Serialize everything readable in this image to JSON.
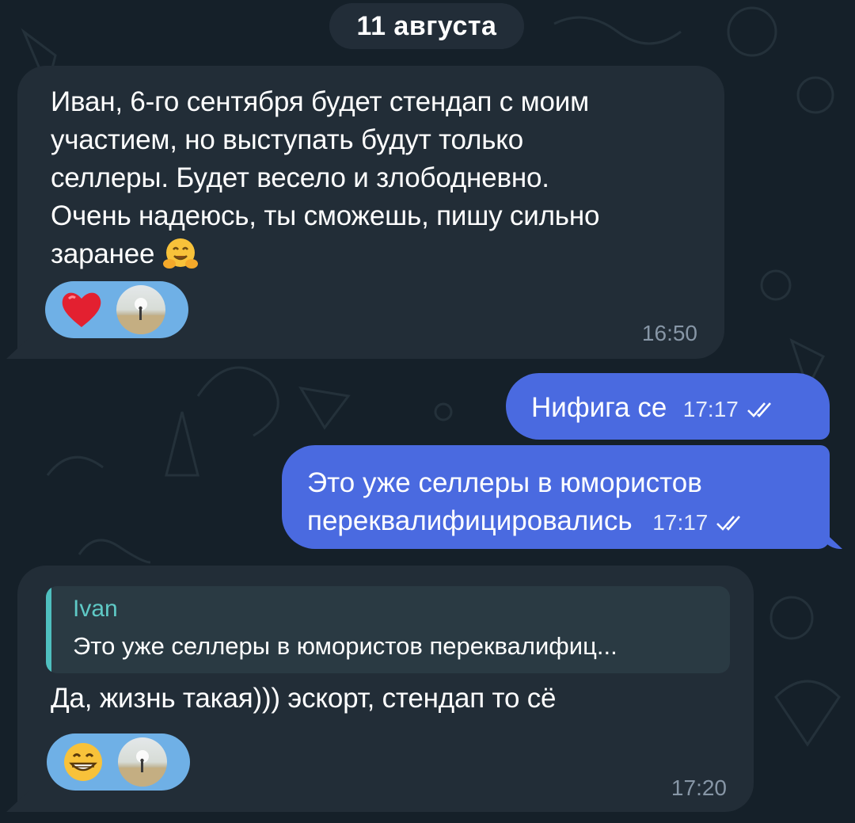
{
  "date_separator": "11 августа",
  "messages": [
    {
      "direction": "incoming",
      "text": "Иван, 6-го сентября будет стендап с моим участием, но выступать будут только селлеры. Будет весело и злободневно. Очень надеюсь, ты сможешь, пишу сильно заранее",
      "lines": [
        "Иван, 6-го сентября будет стендап с моим",
        "участием, но выступать будут только",
        "селлеры. Будет весело и злободневно.",
        "Очень надеюсь, ты сможешь, пишу сильно",
        "заранее"
      ],
      "trailing_emoji": "hugging-face",
      "reaction": "red-heart",
      "time": "16:50"
    },
    {
      "direction": "outgoing",
      "text": "Нифига се",
      "time": "17:17",
      "status": "read"
    },
    {
      "direction": "outgoing",
      "lines": [
        "Это уже селлеры в юмористов",
        "переквалифицировались"
      ],
      "time": "17:17",
      "status": "read"
    },
    {
      "direction": "incoming",
      "reply": {
        "name": "Ivan",
        "text": "Это уже селлеры в юмористов переквалифиц..."
      },
      "text": "Да, жизнь такая))) эскорт, стендап то сё",
      "reaction": "grinning-face",
      "time": "17:20"
    }
  ],
  "colors": {
    "background": "#152029",
    "incoming_bubble": "#222d37",
    "outgoing_bubble": "#4a6ae0",
    "reaction_pill": "#6fb0e6",
    "reply_accent": "#4fbfbf"
  }
}
